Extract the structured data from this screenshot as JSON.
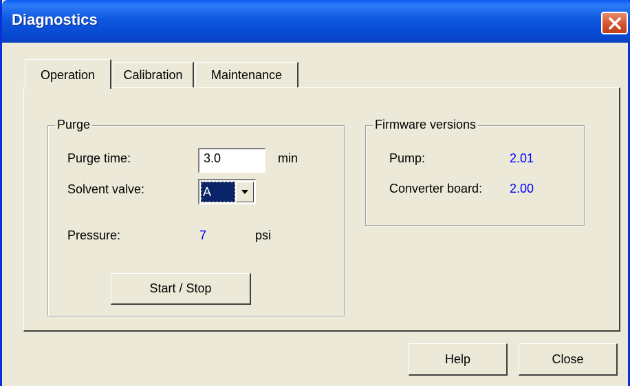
{
  "window": {
    "title": "Diagnostics"
  },
  "tabs": [
    {
      "label": "Operation",
      "active": true
    },
    {
      "label": "Calibration",
      "active": false
    },
    {
      "label": "Maintenance",
      "active": false
    }
  ],
  "purge": {
    "group_label": "Purge",
    "purge_time_label": "Purge time:",
    "purge_time_value": "3.0",
    "purge_time_unit": "min",
    "solvent_valve_label": "Solvent valve:",
    "solvent_valve_value": "A",
    "pressure_label": "Pressure:",
    "pressure_value": "7",
    "pressure_unit": "psi",
    "start_stop_label": "Start / Stop"
  },
  "firmware": {
    "group_label": "Firmware versions",
    "pump_label": "Pump:",
    "pump_value": "2.01",
    "converter_label": "Converter board:",
    "converter_value": "2.00"
  },
  "buttons": {
    "help": "Help",
    "close": "Close"
  },
  "colors": {
    "title_bar": "#0a5cf0",
    "value_text": "#0000ff",
    "close_button": "#d4502c"
  },
  "icons": {
    "close": "close-icon",
    "dropdown": "chevron-down-icon"
  }
}
